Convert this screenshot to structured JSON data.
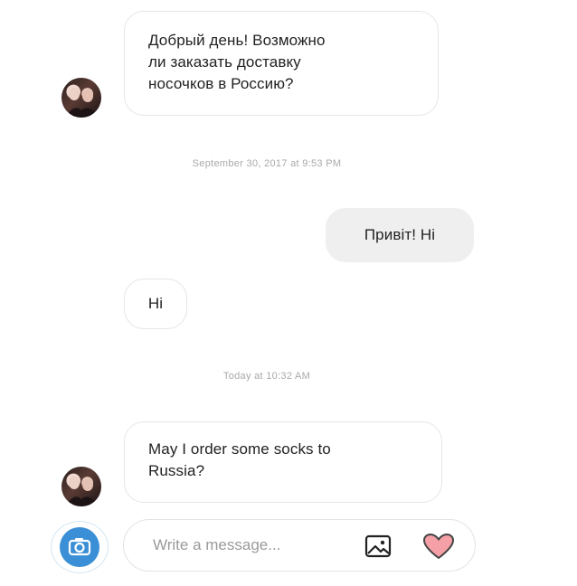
{
  "messages": [
    {
      "direction": "incoming",
      "text": "Добрый день! Возможно ли заказать доставку носочков в Россию?"
    },
    {
      "timestamp": "September 30, 2017 at 9:53 PM"
    },
    {
      "direction": "outgoing",
      "text": "Привіт! Hi"
    },
    {
      "direction": "incoming",
      "text": "Hi"
    },
    {
      "timestamp": "Today at 10:32 AM"
    },
    {
      "direction": "incoming",
      "text": "May I order some socks to Russia?"
    }
  ],
  "msg1": {
    "line1": "Добрый день! Возможно",
    "line2": "ли заказать доставку",
    "line3": "носочков в Россию?"
  },
  "ts1": "September 30, 2017 at 9:53 PM",
  "msg2": "Привіт! Hi",
  "msg3": "Hi",
  "ts2": "Today at 10:32 AM",
  "msg4": {
    "line1": "May I order some socks to",
    "line2": "Russia?"
  },
  "composer": {
    "placeholder": "Write a message..."
  },
  "icons": {
    "camera": "camera-icon",
    "gallery": "image-icon",
    "like": "heart-icon",
    "avatar": "avatar"
  },
  "colors": {
    "camera_blue": "#3a8fd6",
    "incoming_border": "#e6e6e6",
    "outgoing_bg": "#efefef",
    "timestamp": "#a9a9a9"
  }
}
